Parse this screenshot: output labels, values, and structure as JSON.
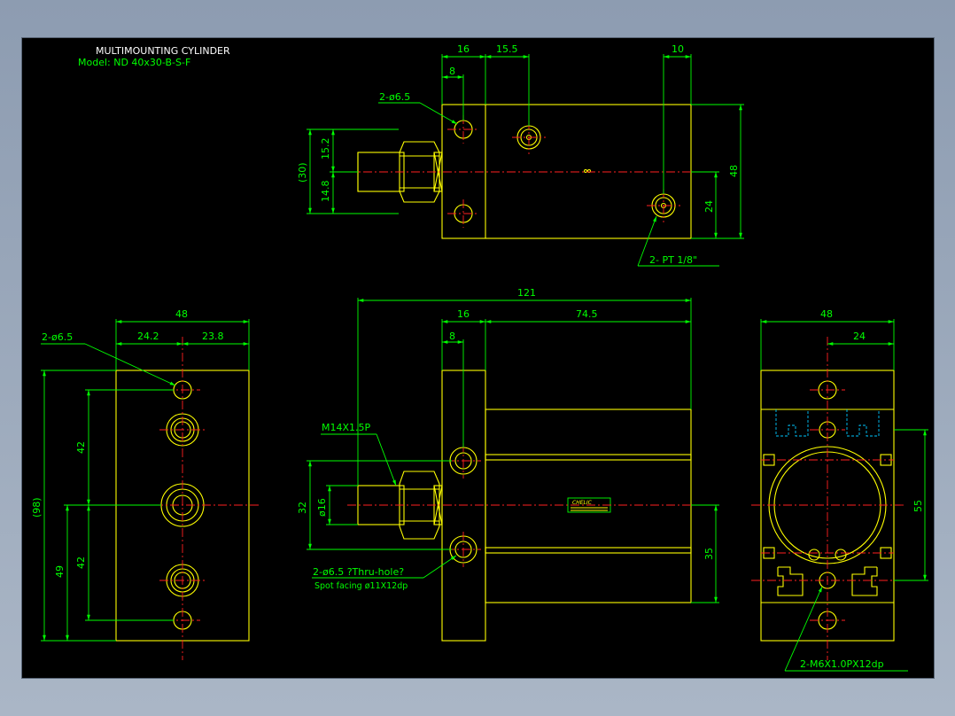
{
  "title": "MULTIMOUNTING CYLINDER",
  "model": "Model: ND 40x30-B-S-F",
  "colors": {
    "outline": "#ffff00",
    "dimension": "#00ff00",
    "centerline": "#ff2020",
    "hidden": "#00c8ff",
    "background": "#000000"
  },
  "top_view": {
    "dims": {
      "d16": "16",
      "d15_5": "15.5",
      "d10": "10",
      "d8": "8",
      "d15_2": "15.2",
      "d14_8": "14.8",
      "d30": "(30)",
      "d48": "48",
      "d24": "24"
    },
    "notes": {
      "holes": "2-ø6.5",
      "ports": "2- PT 1/8\""
    }
  },
  "front_view": {
    "dims": {
      "d121": "121",
      "d16": "16",
      "d74_5": "74.5",
      "d8": "8",
      "d32": "32",
      "d16dia": "ø16",
      "d35": "35"
    },
    "notes": {
      "thread": "M14X1.5P",
      "holes": "2-ø6.5 ?Thru-hole?",
      "spot": "Spot facing  ø11X12dp"
    },
    "brand_label": "CHELIC"
  },
  "left_view": {
    "dims": {
      "d48": "48",
      "d24_2": "24.2",
      "d23_8": "23.8",
      "d42a": "42",
      "d42b": "42",
      "d49": "49",
      "d98": "(98)"
    },
    "notes": {
      "holes": "2-ø6.5"
    }
  },
  "right_view": {
    "dims": {
      "d48": "48",
      "d24": "24",
      "d55": "55"
    },
    "notes": {
      "tapped": "2-M6X1.0PX12dp"
    }
  }
}
